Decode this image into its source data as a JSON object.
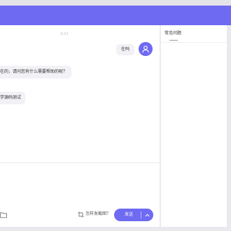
{
  "chat": {
    "timestamp": "8:53",
    "user_message": "在吗",
    "bot_messages": [
      "在的，请问您有什么需要帮助的呢？",
      "学源码测试"
    ]
  },
  "composer": {
    "screenshot_help": "怎样发截图？",
    "send_label": "发送"
  },
  "side": {
    "faq_tab": "常见问题"
  },
  "icons": {
    "avatar": "user-icon",
    "folder": "folder-icon",
    "screenshot": "crop-icon",
    "chevron": "chevron-up-icon"
  },
  "colors": {
    "accent": "#6e6af2",
    "bubble": "#f1f1f6"
  }
}
